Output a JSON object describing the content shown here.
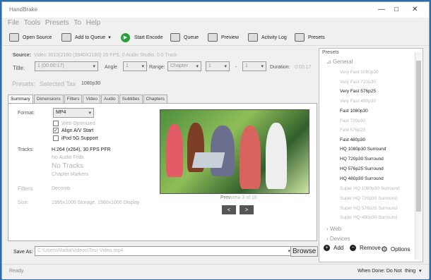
{
  "app": {
    "title": "HandBrake"
  },
  "menu": [
    "File",
    "Tools",
    "Presets",
    "To",
    "Help"
  ],
  "toolbar": {
    "open_source": "Open Source",
    "add_to_queue": "Add to Queue",
    "start_encode": "Start Encode",
    "queue": "Queue",
    "preview": "Preview",
    "activity_log": "Activity Log",
    "presets": "Presets"
  },
  "source": {
    "label": "Source:",
    "value": "Video 3010(2160 (3840X2160) 25 FPS, 0 Audio Studio, 0 0 Track",
    "title_label": "Title:",
    "title_value": "1 (00:00:17)",
    "angle_label": "Angle",
    "angle_value": "1",
    "range_label": "Range:",
    "range_value": "Chapter",
    "range_start": "1",
    "range_sep": "-",
    "range_end": "1",
    "duration_label": "Duration:",
    "duration_value": "0:00:17"
  },
  "presets_selected": {
    "label": "Presets:",
    "selected_label": "Selected Tax",
    "value": "1080p30"
  },
  "tabs": [
    "Summary",
    "Dimensions",
    "Filters",
    "Video",
    "Audio",
    "Subtitles",
    "Chapters"
  ],
  "summary": {
    "format_label": "Format:",
    "format_value": "MP4",
    "web_optimized": "Web Optimized",
    "align_av": "Align A/V Start",
    "ipod": "iPod 5G Support",
    "tracks_label": "Tracks:",
    "tracks_value": "H.264 (x264), 30 FPS PFR",
    "no_audio_finds": "No Audio Frids",
    "no_tracks": "No Tracks",
    "chapter_markers": "Chapter Markers",
    "filters_label": "Filters",
    "filters_value": "Decomb",
    "size_label": "Size:",
    "size_value": "1995x1000 Storage, 1980x1000 Display",
    "preview_caption": "Prev",
    "preview_caption_2": "view 3 of 10",
    "previous": "<",
    "next": ">"
  },
  "save": {
    "label": "Save As:",
    "path": "C:\\Users\\Nadia\\Videos\\Test-Video.mp4",
    "browse": "Browse"
  },
  "sidebar": {
    "title": "Presets",
    "general": "General",
    "items": [
      {
        "name": "Very Fast 1080p30",
        "faded": true
      },
      {
        "name": "Very Fast 720p30",
        "faded": true
      },
      {
        "name": "Very Fast 576p25",
        "faded": false
      },
      {
        "name": "Very Fast 480p30",
        "faded": true
      },
      {
        "name": "Fast 1080p30",
        "faded": false
      },
      {
        "name": "Fast 720p30",
        "faded": true
      },
      {
        "name": "Fast 576p25",
        "faded": true
      },
      {
        "name": "Fast 480p30",
        "faded": false
      },
      {
        "name": "HQ 1080p30 Surround",
        "faded": false
      },
      {
        "name": "HQ 720p30 Surround",
        "faded": false
      },
      {
        "name": "HQ 576p25 Surround",
        "faded": false
      },
      {
        "name": "HQ 480p30 Surround",
        "faded": false
      },
      {
        "name": "Super HQ 1080p30 Surround",
        "faded": true
      },
      {
        "name": "Super HQ 720p30 Surround",
        "faded": true
      },
      {
        "name": "Super HQ 576p25 Surround",
        "faded": true
      },
      {
        "name": "Super HQ 480p30 Surround",
        "faded": true
      }
    ],
    "web": "Web",
    "devices": "Devices",
    "add": "Add",
    "remove": "Remove",
    "options": "Options"
  },
  "status": {
    "ready": "Ready",
    "when_done": "When Done: Do Not",
    "when_done_value": "thing"
  }
}
